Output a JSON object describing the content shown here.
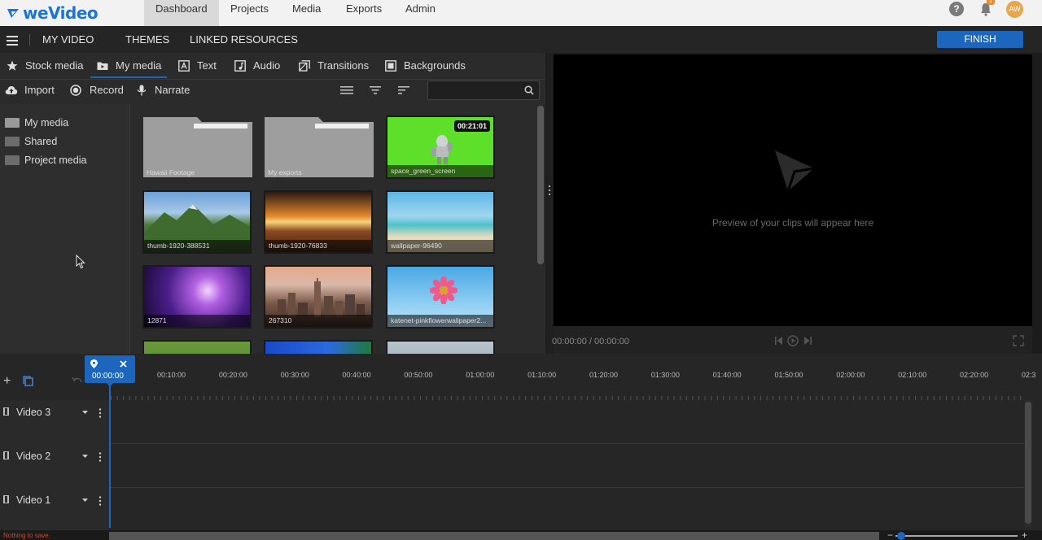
{
  "brand": {
    "name": "weVideo",
    "color": "#1d74d8"
  },
  "topnav": {
    "items": [
      "Dashboard",
      "Projects",
      "Media",
      "Exports",
      "Admin"
    ],
    "active": "Dashboard",
    "help_label": "?",
    "notification_badge": "1",
    "avatar_initials": "AW"
  },
  "subbar": {
    "project_title": "MY VIDEO",
    "themes": "THEMES",
    "linked_resources": "LINKED RESOURCES",
    "finish": "FINISH"
  },
  "library": {
    "tabs": [
      {
        "label": "Stock media",
        "icon": "star-icon"
      },
      {
        "label": "My media",
        "icon": "media-folder-icon"
      },
      {
        "label": "Text",
        "icon": "text-icon"
      },
      {
        "label": "Audio",
        "icon": "audio-icon"
      },
      {
        "label": "Transitions",
        "icon": "transitions-icon"
      },
      {
        "label": "Backgrounds",
        "icon": "backgrounds-icon"
      }
    ],
    "active_tab": "My media",
    "tools": [
      {
        "label": "Import",
        "icon": "cloud-upload-icon"
      },
      {
        "label": "Record",
        "icon": "record-icon"
      },
      {
        "label": "Narrate",
        "icon": "microphone-icon"
      }
    ],
    "search_placeholder": "",
    "sidebar": [
      "My media",
      "Shared",
      "Project media"
    ],
    "tiles": [
      {
        "caption": "Hawaii Footage",
        "kind": "folder"
      },
      {
        "caption": "My exports",
        "kind": "folder"
      },
      {
        "caption": "space_green_screen",
        "kind": "video",
        "duration": "00:21:01"
      },
      {
        "caption": "thumb-1920-388531",
        "kind": "image"
      },
      {
        "caption": "thumb-1920-76833",
        "kind": "image"
      },
      {
        "caption": "wallpaper-96490",
        "kind": "image"
      },
      {
        "caption": "12871",
        "kind": "image"
      },
      {
        "caption": "267310",
        "kind": "image"
      },
      {
        "caption": "katenet-pinkflowerwallpaper2...",
        "kind": "image"
      },
      {
        "caption": "",
        "kind": "image"
      },
      {
        "caption": "",
        "kind": "image"
      },
      {
        "caption": "",
        "kind": "image"
      }
    ]
  },
  "preview": {
    "placeholder": "Preview of your clips will appear here",
    "time": "00:00:00 / 00:00:00"
  },
  "timeline": {
    "playhead_time": "00:00:00",
    "ticks": [
      "00:10:00",
      "00:20:00",
      "00:30:00",
      "00:40:00",
      "00:50:00",
      "01:00:00",
      "01:10:00",
      "01:20:00",
      "01:30:00",
      "01:40:00",
      "01:50:00",
      "02:00:00",
      "02:10:00",
      "02:20:00",
      "02:3"
    ],
    "tracks": [
      "Video 3",
      "Video 2",
      "Video 1"
    ],
    "status": "Nothing to save.",
    "zoom_minus": "−",
    "zoom_plus": "+"
  }
}
